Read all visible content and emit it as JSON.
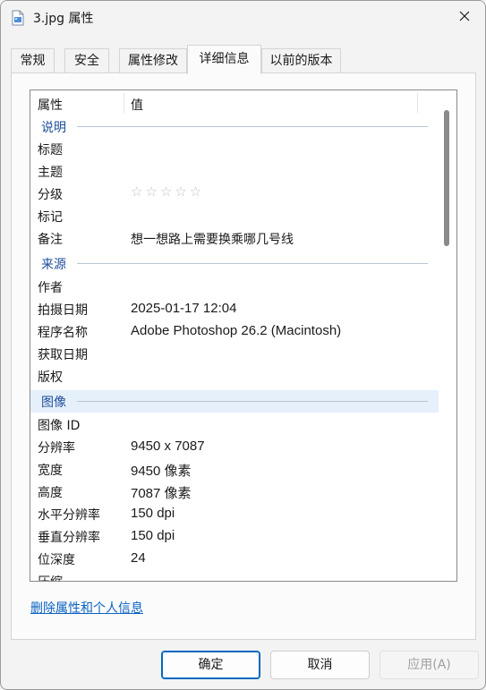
{
  "window": {
    "title": "3.jpg 属性"
  },
  "tabs": [
    "常规",
    "安全",
    "属性修改",
    "详细信息",
    "以前的版本"
  ],
  "list": {
    "header": {
      "property": "属性",
      "value": "值"
    },
    "groups": {
      "description": "说明",
      "origin": "来源",
      "image": "图像"
    },
    "rows": {
      "title": {
        "k": "标题",
        "v": ""
      },
      "subject": {
        "k": "主题",
        "v": ""
      },
      "rating": {
        "k": "分级",
        "v": "☆☆☆☆☆",
        "stars_filled": 0,
        "stars_total": 5
      },
      "tags": {
        "k": "标记",
        "v": ""
      },
      "comments": {
        "k": "备注",
        "v": "想一想路上需要换乘哪几号线"
      },
      "author": {
        "k": "作者",
        "v": ""
      },
      "date_taken": {
        "k": "拍摄日期",
        "v": "2025-01-17 12:04"
      },
      "program": {
        "k": "程序名称",
        "v": "Adobe Photoshop 26.2 (Macintosh)"
      },
      "date_acquired": {
        "k": "获取日期",
        "v": ""
      },
      "copyright": {
        "k": "版权",
        "v": ""
      },
      "image_id": {
        "k": "图像 ID",
        "v": ""
      },
      "dimensions": {
        "k": "分辨率",
        "v": "9450 x 7087"
      },
      "width": {
        "k": "宽度",
        "v": "9450 像素"
      },
      "height": {
        "k": "高度",
        "v": "7087 像素"
      },
      "hres": {
        "k": "水平分辨率",
        "v": "150 dpi"
      },
      "vres": {
        "k": "垂直分辨率",
        "v": "150 dpi"
      },
      "bitdepth": {
        "k": "位深度",
        "v": "24"
      },
      "compression": {
        "k": "压缩",
        "v": ""
      }
    }
  },
  "remove_link": "删除属性和个人信息",
  "buttons": {
    "ok": "确定",
    "cancel": "取消",
    "apply": "应用(A)"
  }
}
